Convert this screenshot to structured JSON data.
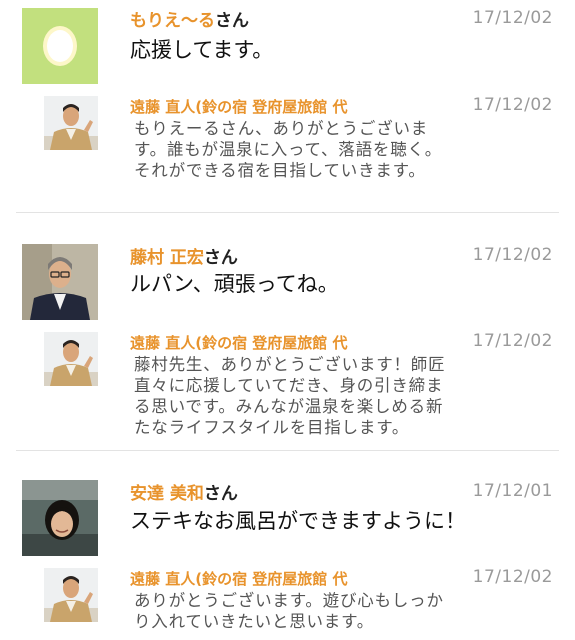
{
  "honorific": "さん",
  "comments": [
    {
      "name": "もりえ〜る",
      "date": "17/12/02",
      "message": "応援してます。",
      "reply": {
        "name": "遠藤 直人(鈴の宿 登府屋旅館 代",
        "date": "17/12/02",
        "lines": [
          "もりえーるさん、ありがとうございま",
          "す。誰もが温泉に入って、落語を聴く。",
          "それができる宿を目指していきます。"
        ]
      }
    },
    {
      "name": "藤村 正宏",
      "date": "17/12/02",
      "message": "ルパン、頑張ってね。",
      "reply": {
        "name": "遠藤 直人(鈴の宿 登府屋旅館 代",
        "date": "17/12/02",
        "lines": [
          "藤村先生、ありがとうございます！師匠",
          "直々に応援していてだき、身の引き締ま",
          "る思いです。みんなが温泉を楽しめる新",
          "たなライフスタイルを目指します。"
        ]
      }
    },
    {
      "name": "安達 美和",
      "date": "17/12/01",
      "message": "ステキなお風呂ができますように！",
      "reply": {
        "name": "遠藤 直人(鈴の宿 登府屋旅館 代",
        "date": "17/12/02",
        "lines": [
          "ありがとうございます。遊び心もしっか",
          "り入れていきたいと思います。"
        ]
      }
    }
  ]
}
